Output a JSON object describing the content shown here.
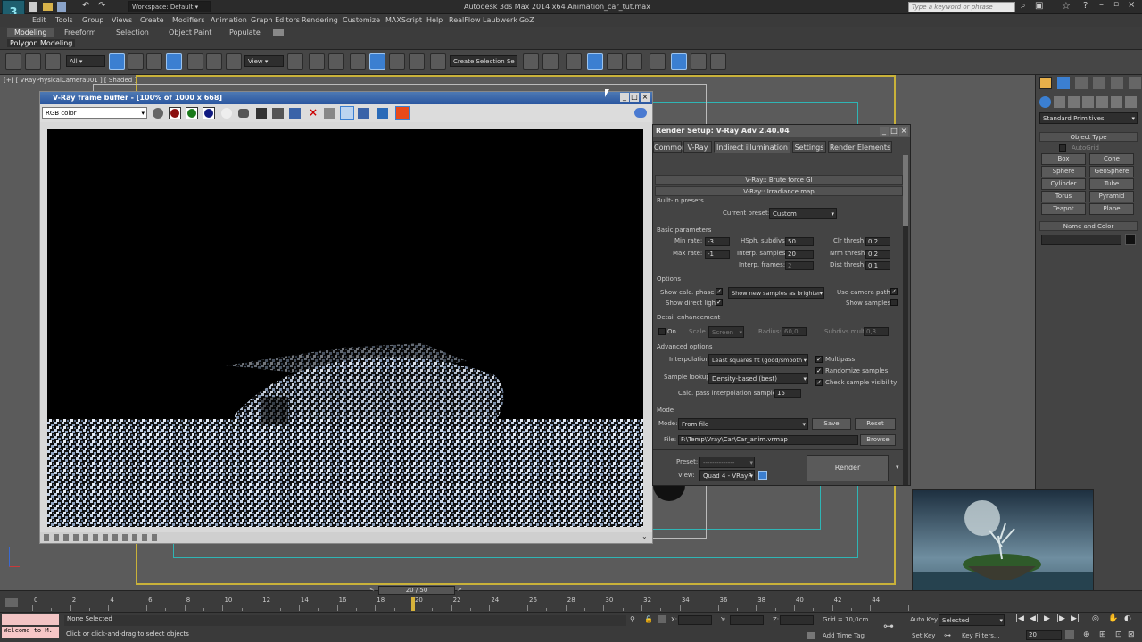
{
  "app": {
    "title": "Autodesk 3ds Max  2014 x64     Animation_car_tut.max",
    "workspace": "Workspace: Default",
    "search_placeholder": "Type a keyword or phrase"
  },
  "menu": [
    "Edit",
    "Tools",
    "Group",
    "Views",
    "Create",
    "Modifiers",
    "Animation",
    "Graph Editors",
    "Rendering",
    "Customize",
    "MAXScript",
    "Help",
    "RealFlow",
    "Laubwerk",
    "GoZ"
  ],
  "ribbon": {
    "tabs": [
      "Modeling",
      "Freeform",
      "Selection",
      "Object Paint",
      "Populate"
    ],
    "sub_label": "Polygon Modeling"
  },
  "toolbar": {
    "filter": "All",
    "ref_coord": "View",
    "selection_set": "Create Selection Se"
  },
  "viewport": {
    "label": "[+] [ VRayPhysicalCamera001 ] [ Shaded ]"
  },
  "vfb": {
    "title": "V-Ray frame buffer - [100% of 1000 x 668]",
    "channel": "RGB color"
  },
  "render_setup": {
    "title": "Render Setup: V-Ray Adv 2.40.04",
    "tabs": [
      "Common",
      "V-Ray",
      "Indirect illumination",
      "Settings",
      "Render Elements"
    ],
    "active_tab": "Indirect illumination",
    "rollout_brute": "V-Ray:: Brute force GI",
    "rollout_irradiance": "V-Ray:: Irradiance map",
    "builtin_presets": "Built-in presets",
    "current_preset_label": "Current preset:",
    "current_preset": "Custom",
    "basic_params": "Basic parameters",
    "min_rate_label": "Min rate:",
    "min_rate": "-3",
    "max_rate_label": "Max rate:",
    "max_rate": "-1",
    "hsph_label": "HSph. subdivs:",
    "hsph": "50",
    "interp_samples_label": "Interp. samples:",
    "interp_samples": "20",
    "interp_frames_label": "Interp. frames:",
    "interp_frames": "2",
    "clr_thresh_label": "Clr thresh:",
    "clr_thresh": "0,2",
    "nrm_thresh_label": "Nrm thresh:",
    "nrm_thresh": "0,2",
    "dist_thresh_label": "Dist thresh:",
    "dist_thresh": "0,1",
    "options": "Options",
    "show_calc_label": "Show calc. phase",
    "show_direct_label": "Show direct light",
    "show_new_samples": "Show new samples as brighter",
    "use_camera_path_label": "Use camera path",
    "show_samples_label": "Show samples",
    "detail_enh": "Detail enhancement",
    "on_label": "On",
    "scale_label": "Scale",
    "scale": "Screen",
    "radius_label": "Radius:",
    "radius": "60,0",
    "subdivs_mult_label": "Subdivs mult.",
    "subdivs_mult": "0,3",
    "advanced": "Advanced options",
    "interpolation_label": "Interpolation",
    "interpolation": "Least squares fit (good/smooth",
    "sample_lookup_label": "Sample lookup",
    "sample_lookup": "Density-based (best)",
    "calc_pass_label": "Calc. pass interpolation samples:",
    "calc_pass": "15",
    "multipass_label": "Multipass",
    "randomize_label": "Randomize samples",
    "check_vis_label": "Check sample visibility",
    "mode_section": "Mode",
    "mode_label": "Mode:",
    "mode": "From file",
    "save_label": "Save",
    "reset_label": "Reset",
    "file_label": "File:",
    "file_path": "F:\\Temp\\Vray\\Car\\Car_anim.vrmap",
    "browse_label": "Browse",
    "preset_label": "Preset:",
    "view_label": "View:",
    "view_value": "Quad 4 - VRayP",
    "render_label": "Render"
  },
  "command_panel": {
    "category": "Standard Primitives",
    "object_type_header": "Object Type",
    "autogrid_label": "AutoGrid",
    "primitives": [
      "Box",
      "Cone",
      "Sphere",
      "GeoSphere",
      "Cylinder",
      "Tube",
      "Torus",
      "Pyramid",
      "Teapot",
      "Plane"
    ],
    "name_color_header": "Name and Color"
  },
  "timeline": {
    "frame_indicator": "20 / 50",
    "ticks": [
      "0",
      "2",
      "4",
      "6",
      "8",
      "10",
      "12",
      "14",
      "16",
      "18",
      "20",
      "22",
      "24",
      "26",
      "28",
      "30",
      "32",
      "34",
      "36",
      "38",
      "40",
      "42",
      "44"
    ],
    "current_frame": 20,
    "total_frames": 50
  },
  "status": {
    "maxscript": "Welcome to M.",
    "selection": "None Selected",
    "prompt": "Click or click-and-drag to select objects",
    "x_label": "X:",
    "y_label": "Y:",
    "z_label": "Z:",
    "grid": "Grid = 10,0cm",
    "add_time_tag": "Add Time Tag",
    "auto_key": "Auto Key",
    "selected": "Selected",
    "set_key": "Set Key",
    "key_filters": "Key Filters...",
    "frame_field": "20"
  },
  "colors": {
    "accent": "#3b7fd1",
    "viewport_border": "#c9b23a",
    "safe_frame": "#2fb5b5"
  }
}
